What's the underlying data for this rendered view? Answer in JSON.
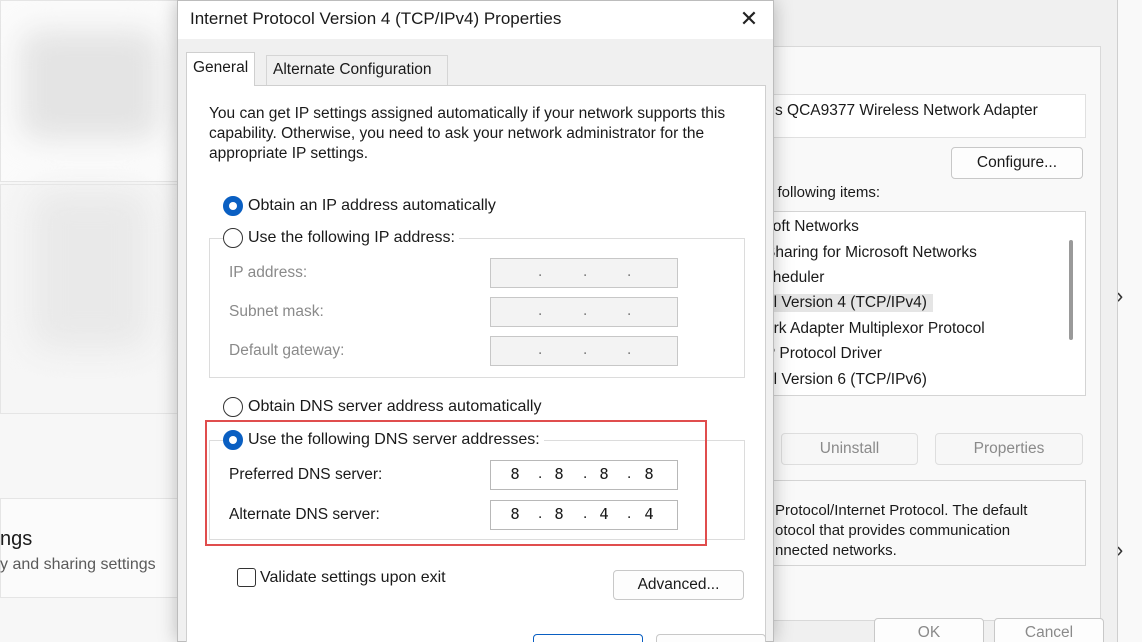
{
  "background": {
    "section_title": "ngs",
    "section_subtitle": "y and sharing settings",
    "chevron": "›"
  },
  "wifi_properties": {
    "adapter_name": "s QCA9377 Wireless Network Adapter",
    "configure_label": "Configure...",
    "items_label": "e following items:",
    "items": [
      "soft Networks",
      "Sharing for Microsoft Networks",
      "cheduler",
      "ol Version 4 (TCP/IPv4)",
      "ork Adapter Multiplexor Protocol",
      "P Protocol Driver",
      "ol Version 6 (TCP/IPv6)"
    ],
    "uninstall_label": "Uninstall",
    "properties_label": "Properties",
    "description": "Protocol/Internet Protocol. The default\notocol that provides communication\nnnected networks.",
    "ok_label": "OK",
    "cancel_label": "Cancel"
  },
  "dialog": {
    "title": "Internet Protocol Version 4 (TCP/IPv4) Properties",
    "close_glyph": "✕",
    "tabs": [
      "General",
      "Alternate Configuration"
    ],
    "intro_text": "You can get IP settings assigned automatically if your network supports this capability. Otherwise, you need to ask your network administrator for the appropriate IP settings.",
    "ip_auto_label": "Obtain an IP address automatically",
    "ip_manual_label": "Use the following IP address:",
    "ip_fields": {
      "ip_address_label": "IP address:",
      "subnet_mask_label": "Subnet mask:",
      "default_gateway_label": "Default gateway:",
      "dot": "."
    },
    "dns_auto_label": "Obtain DNS server address automatically",
    "dns_manual_label": "Use the following DNS server addresses:",
    "preferred_dns_label": "Preferred DNS server:",
    "preferred_dns": [
      "8",
      "8",
      "8",
      "8"
    ],
    "alternate_dns_label": "Alternate DNS server:",
    "alternate_dns": [
      "8",
      "8",
      "4",
      "4"
    ],
    "validate_label": "Validate settings upon exit",
    "advanced_label": "Advanced...",
    "selected_radio_color": "#0a5fc2",
    "highlight_color": "#e04d4d"
  }
}
